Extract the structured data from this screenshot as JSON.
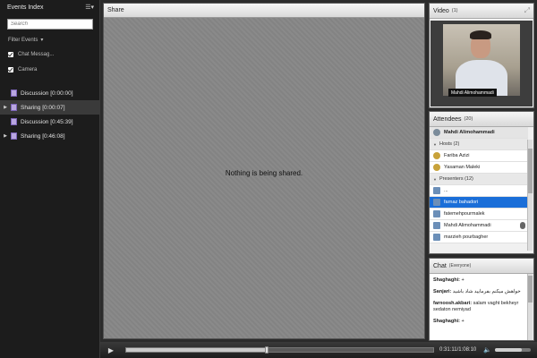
{
  "events_panel": {
    "title": "Events Index",
    "search_placeholder": "Search",
    "filter_label": "Filter Events",
    "filters": [
      {
        "label": "Chat Messag...",
        "checked": true
      },
      {
        "label": "Camera",
        "checked": true
      }
    ],
    "events": [
      {
        "label": "Discussion [0:00:00]",
        "expandable": false,
        "selected": false
      },
      {
        "label": "Sharing [0:00:07]",
        "expandable": true,
        "selected": true
      },
      {
        "label": "Discussion [0:45:39]",
        "expandable": false,
        "selected": false
      },
      {
        "label": "Sharing [0:46:08]",
        "expandable": true,
        "selected": false
      }
    ]
  },
  "share_pod": {
    "title": "Share",
    "message": "Nothing is being shared."
  },
  "video_pod": {
    "title": "Video",
    "count": "(1)",
    "camera_name": "Mahdi Alimohammadi"
  },
  "attendees_pod": {
    "title": "Attendees",
    "count": "(20)",
    "current_user": "Mahdi Alimohammadi",
    "hosts_label": "Hosts (2)",
    "hosts": [
      "Fariba Azizi",
      "Yasaman Maleki"
    ],
    "presenters_label": "Presenters (12)",
    "presenters": [
      {
        "name": "...",
        "selected": false,
        "mic": false
      },
      {
        "name": "farnaz bahadori",
        "selected": true,
        "mic": false
      },
      {
        "name": "fatemehpourmalek",
        "selected": false,
        "mic": false
      },
      {
        "name": "Mahdi Alimohammadi",
        "selected": false,
        "mic": true
      },
      {
        "name": "marzieh pourbagher",
        "selected": false,
        "mic": false
      }
    ]
  },
  "chat_pod": {
    "title": "Chat",
    "scope": "(Everyone)",
    "messages": [
      {
        "sender": "Shaghaghi:",
        "text": "+"
      },
      {
        "sender": "Sanjari:",
        "text": "خواهش میکنم بفرمایید شاد باشید"
      },
      {
        "sender": "farnoosh.akbari:",
        "text": "salam vaght bekheyr sedaton nemiyad"
      },
      {
        "sender": "Shaghaghi:",
        "text": "+"
      }
    ]
  },
  "playback": {
    "time": "0:31:11/1:08:10",
    "progress": 0.457,
    "volume": 0.75
  },
  "colors": {
    "selected_row": "#1a6ed8",
    "panel_bg": "#1c1c1c",
    "share_bg": "#858585"
  }
}
